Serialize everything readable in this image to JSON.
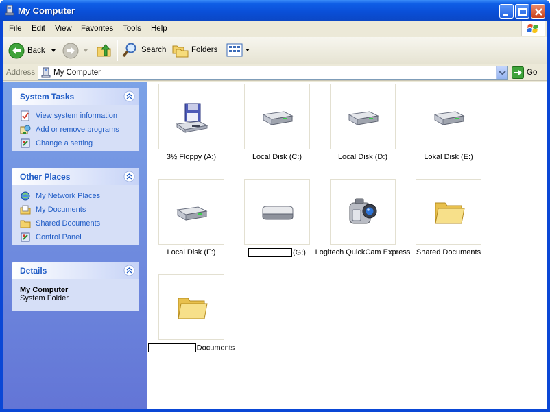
{
  "window": {
    "title": "My Computer"
  },
  "menu": [
    "File",
    "Edit",
    "View",
    "Favorites",
    "Tools",
    "Help"
  ],
  "toolbar": {
    "back": "Back",
    "search": "Search",
    "folders": "Folders"
  },
  "address": {
    "label": "Address",
    "value": "My Computer",
    "go": "Go"
  },
  "panels": {
    "system_tasks": {
      "title": "System Tasks",
      "items": [
        "View system information",
        "Add or remove programs",
        "Change a setting"
      ]
    },
    "other_places": {
      "title": "Other Places",
      "items": [
        "My Network Places",
        "My Documents",
        "Shared Documents",
        "Control Panel"
      ]
    },
    "details": {
      "title": "Details",
      "name": "My Computer",
      "sub": "System Folder"
    }
  },
  "items": [
    {
      "label": "3½ Floppy (A:)",
      "icon": "floppy-drive-icon"
    },
    {
      "label": "Local Disk (C:)",
      "icon": "hard-disk-icon"
    },
    {
      "label": "Local Disk (D:)",
      "icon": "hard-disk-icon"
    },
    {
      "label": "Lokal Disk (E:)",
      "icon": "hard-disk-icon"
    },
    {
      "label": "Local Disk (F:)",
      "icon": "hard-disk-icon"
    },
    {
      "label": "(G:)",
      "icon": "removable-disk-icon"
    },
    {
      "label": "Logitech QuickCam Express",
      "icon": "webcam-icon"
    },
    {
      "label": "Shared Documents",
      "icon": "folder-icon"
    },
    {
      "label": "Documents",
      "icon": "folder-icon"
    }
  ]
}
